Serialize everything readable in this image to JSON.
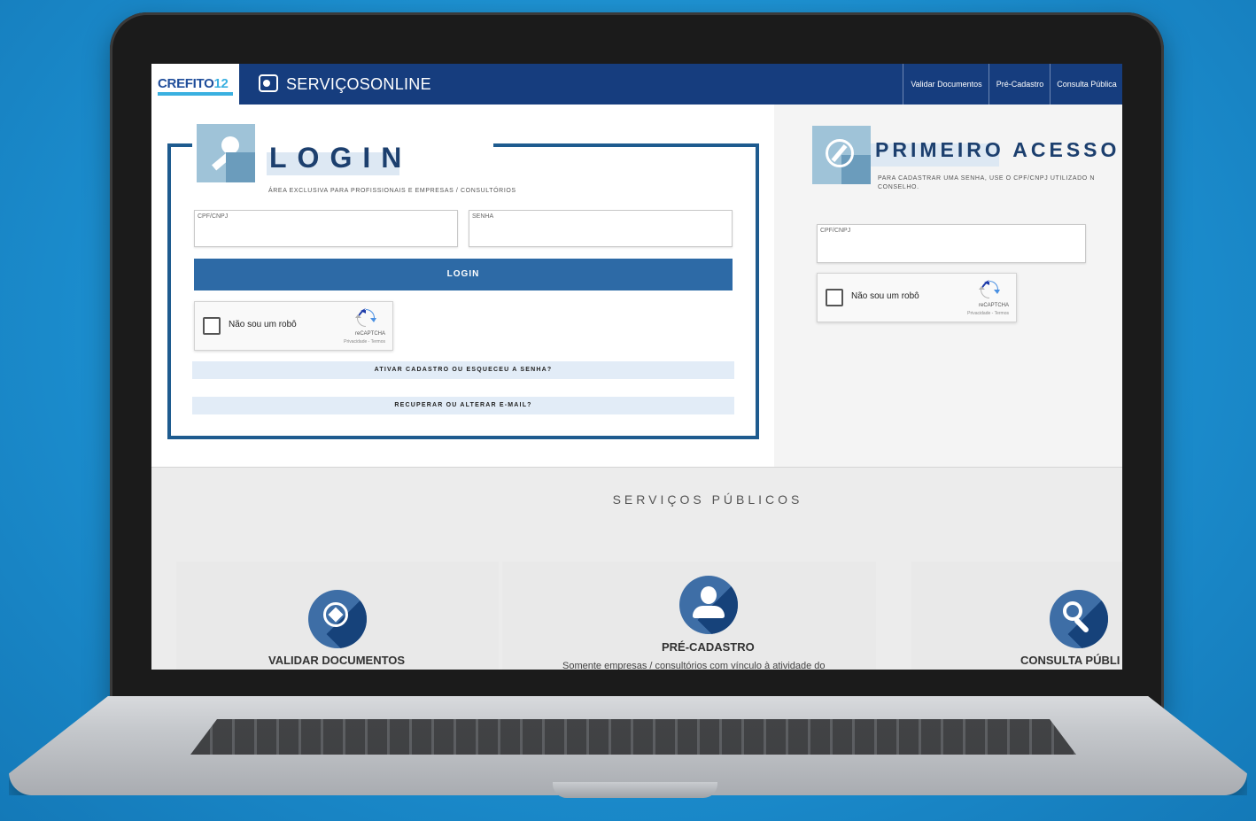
{
  "header": {
    "logo_main": "CREFITO",
    "logo_num": "12",
    "service_title": "SERVIÇOSONLINE",
    "nav": [
      {
        "label": "Validar Documentos"
      },
      {
        "label": "Pré-Cadastro"
      },
      {
        "label": "Consulta Pública"
      }
    ]
  },
  "login": {
    "title": "LOGIN",
    "subtitle": "ÁREA EXCLUSIVA PARA PROFISSIONAIS E EMPRESAS / CONSULTÓRIOS",
    "cpf_label": "CPF/CNPJ",
    "senha_label": "SENHA",
    "button_label": "LOGIN",
    "captcha_label": "Não sou um robô",
    "captcha_brand": "reCAPTCHA",
    "captcha_terms": "Privacidade - Termos",
    "link_activate": "ATIVAR CADASTRO OU ESQUECEU A SENHA?",
    "link_email": "RECUPERAR OU ALTERAR E-MAIL?"
  },
  "primeiro_acesso": {
    "title": "PRIMEIRO ACESSO",
    "subtitle_line1": "PARA CADASTRAR UMA SENHA, USE O CPF/CNPJ UTILIZADO N",
    "subtitle_line2": "CONSELHO.",
    "cpf_label": "CPF/CNPJ",
    "captcha_label": "Não sou um robô",
    "captcha_brand": "reCAPTCHA",
    "captcha_terms": "Privacidade - Termos"
  },
  "services": {
    "title": "SERVIÇOS PÚBLICOS",
    "cards": [
      {
        "label": "VALIDAR DOCUMENTOS",
        "icon": "seal-icon"
      },
      {
        "label": "PRÉ-CADASTRO",
        "icon": "user-icon",
        "description": "Somente empresas / consultórios com vínculo à atividade do"
      },
      {
        "label": "CONSULTA PÚBLI",
        "icon": "search-icon"
      }
    ]
  },
  "colors": {
    "navbar": "#163d7e",
    "primary_button": "#2d6aa6",
    "frame": "#1e5b8f",
    "background": "#1c8fd0"
  }
}
